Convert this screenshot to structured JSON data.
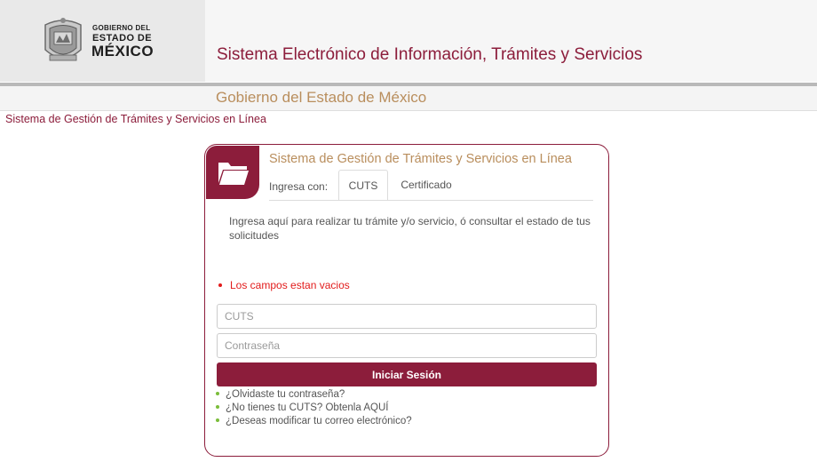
{
  "header": {
    "logo_line1": "GOBIERNO DEL",
    "logo_line2": "ESTADO DE",
    "logo_line3": "MÉXICO",
    "title": "Sistema Electrónico de Información, Trámites y Servicios"
  },
  "subheader": {
    "title": "Gobierno del Estado de México"
  },
  "breadcrumb": "Sistema de Gestión de Trámites y Servicios en Línea",
  "card": {
    "title": "Sistema de Gestión de Trámites y Servicios en Línea",
    "ingresa_label": "Ingresa con:",
    "tabs": [
      {
        "label": "CUTS",
        "active": true
      },
      {
        "label": "Certificado",
        "active": false
      }
    ],
    "instruction": "Ingresa aquí para realizar tu trámite y/o servicio, ó consultar el estado de tus solicitudes",
    "error": "Los campos estan vacios",
    "cuts_placeholder": "CUTS",
    "password_placeholder": "Contraseña",
    "login_label": "Iniciar Sesión",
    "links": [
      "¿Olvidaste tu contraseña?",
      "¿No tienes tu CUTS? Obtenla AQUÍ",
      "¿Deseas modificar tu correo electrónico?"
    ]
  },
  "colors": {
    "brand": "#8c1d3b",
    "gold": "#b98e5d",
    "error": "#e21b1b",
    "bullet": "#7bbd3a"
  },
  "icons": {
    "seal": "state-seal-icon",
    "folder": "folder-icon"
  }
}
